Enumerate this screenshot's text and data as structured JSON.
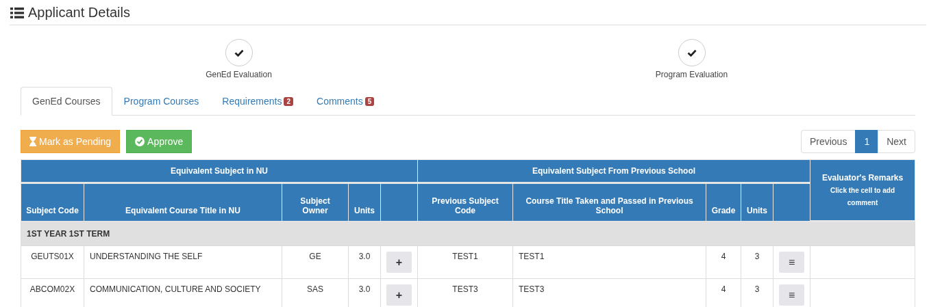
{
  "title": "Applicant Details",
  "steps": [
    {
      "label": "GenEd Evaluation",
      "checked": true
    },
    {
      "label": "Program Evaluation",
      "checked": true
    }
  ],
  "tabs": [
    {
      "label": "GenEd Courses",
      "selected": true
    },
    {
      "label": "Program Courses",
      "selected": false
    },
    {
      "label": "Requirements",
      "badge": "2",
      "selected": false
    },
    {
      "label": "Comments",
      "badge": "5",
      "selected": false
    }
  ],
  "actions": [
    {
      "kind": "pending",
      "label": "Mark as Pending"
    },
    {
      "kind": "approve",
      "label": "Approve"
    }
  ],
  "pagination": [
    {
      "label": "Previous",
      "selected": false
    },
    {
      "label": "1",
      "selected": true
    },
    {
      "label": "Next",
      "selected": false
    }
  ],
  "table": {
    "groups": [
      "Equivalent Subject in NU",
      "Equivalent Subject From Previous School"
    ],
    "remarks_header": "Evaluator's Remarks",
    "remarks_hint": "Click the cell to add comment",
    "columns": [
      "Subject Code",
      "Equivalent Course Title in NU",
      "Subject Owner",
      "Units",
      "",
      "Previous Subject Code",
      "Course Title Taken and Passed in Previous School",
      "Grade",
      "Units"
    ],
    "term": "1ST YEAR 1ST TERM",
    "rows": [
      {
        "code": "GEUTS01X",
        "title": "UNDERSTANDING THE SELF",
        "owner": "GE",
        "units": "3.0",
        "add": "+",
        "prev_code": "TEST1",
        "prev_title": "TEST1",
        "grade": "4",
        "prev_units": "3",
        "menu": "≡"
      },
      {
        "code": "ABCOM02X",
        "title": "COMMUNICATION, CULTURE AND SOCIETY",
        "owner": "SAS",
        "units": "3.0",
        "add": "+",
        "prev_code": "TEST3",
        "prev_title": "TEST3",
        "grade": "4",
        "prev_units": "3",
        "menu": "≡"
      }
    ]
  }
}
